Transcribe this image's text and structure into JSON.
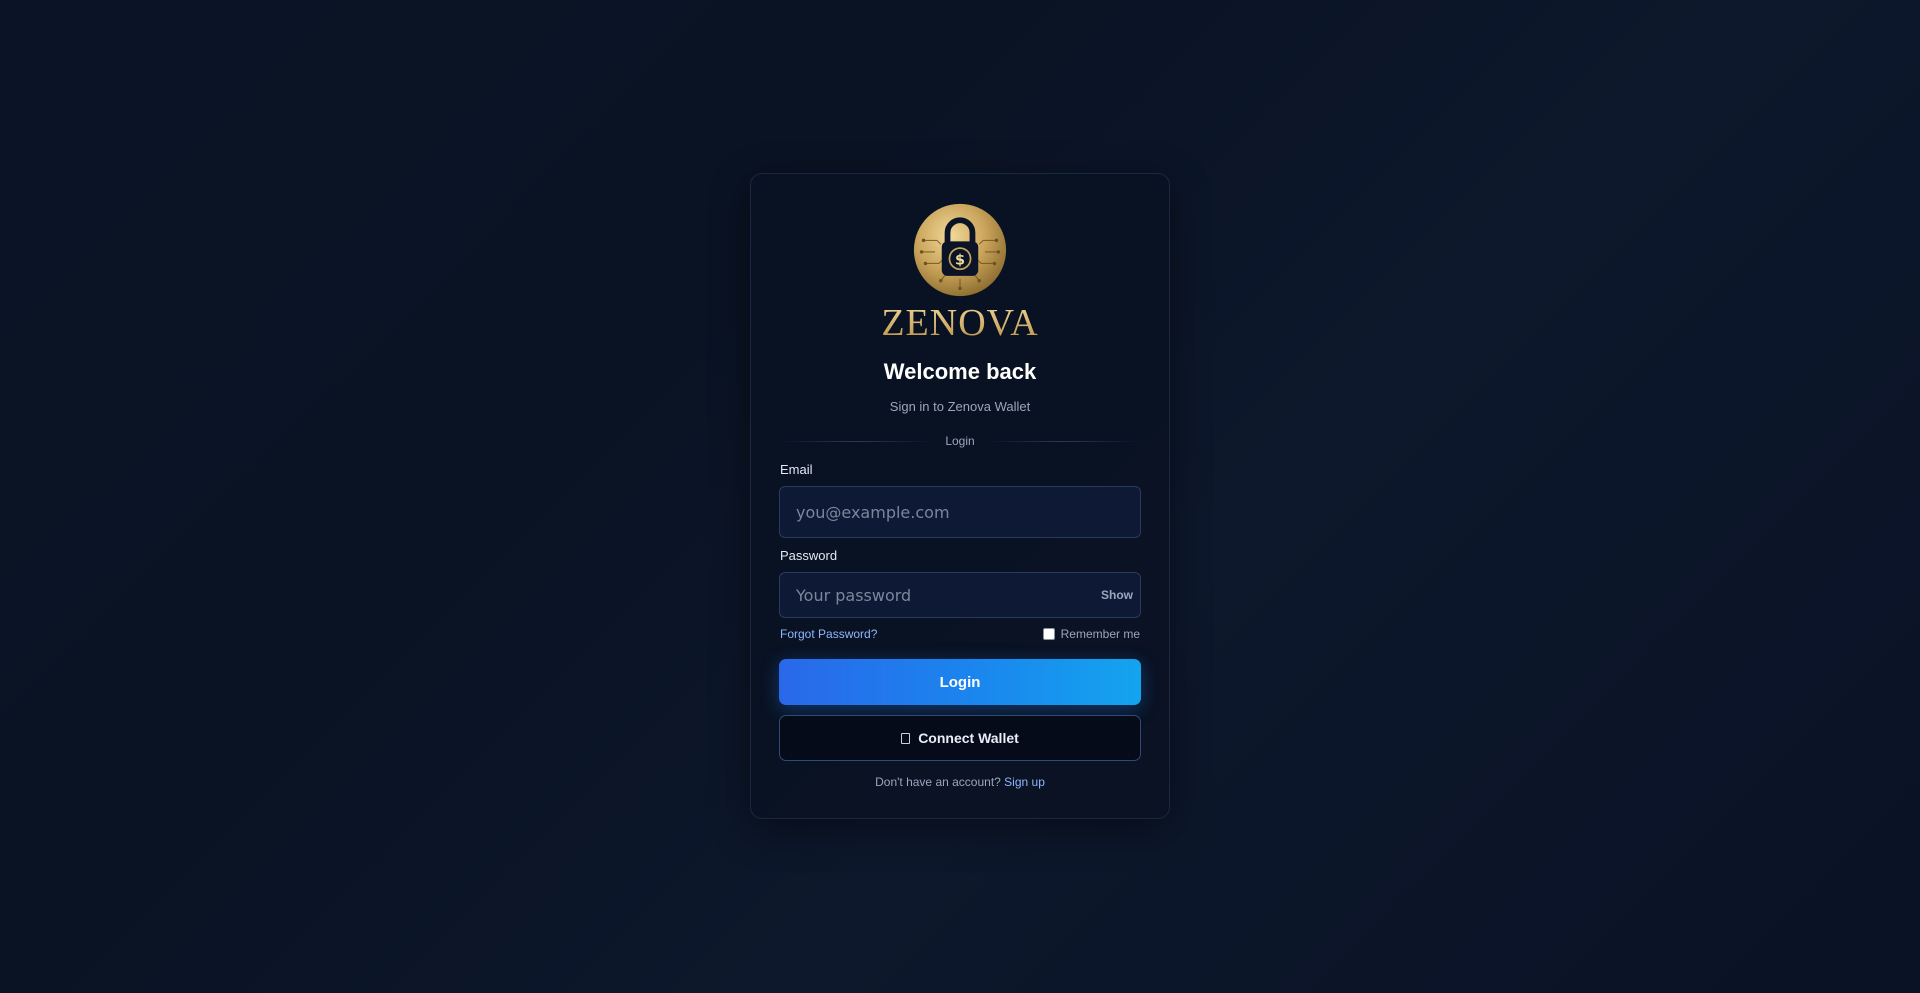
{
  "brand": {
    "name": "ZENOVA",
    "logo_icon": "padlock-dollar-coin-icon",
    "gold_color": "#c9a35a"
  },
  "header": {
    "title": "Welcome back",
    "subtitle": "Sign in to Zenova Wallet"
  },
  "divider": {
    "label": "Login"
  },
  "form": {
    "email": {
      "label": "Email",
      "placeholder": "you@example.com",
      "value": ""
    },
    "password": {
      "label": "Password",
      "placeholder": "Your password",
      "value": "",
      "toggle_label": "Show"
    },
    "forgot_label": "Forgot Password?",
    "remember_label": "Remember me",
    "remember_checked": false
  },
  "actions": {
    "login_label": "Login",
    "wallet_label": "Connect Wallet",
    "wallet_icon": "wallet-icon"
  },
  "footer": {
    "prompt": "Don't have an account?",
    "signup_label": "Sign up"
  },
  "colors": {
    "accent_start": "#2a68ea",
    "accent_end": "#14a4ee",
    "link": "#8fb6ff",
    "background": "#0b1426"
  }
}
